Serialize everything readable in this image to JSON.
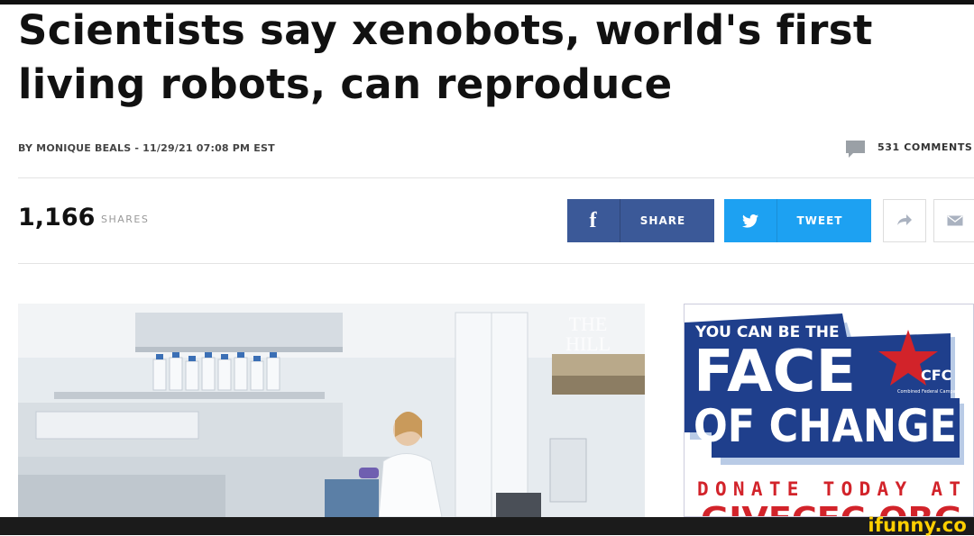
{
  "article": {
    "headline_line1": "Scientists say xenobots, world's first",
    "headline_line2": "living robots, can reproduce",
    "byline": "BY MONIQUE BEALS - 11/29/21 07:08 PM EST",
    "comments": "531 COMMENTS"
  },
  "share_bar": {
    "count": "1,166",
    "count_label": "SHARES",
    "facebook_label": "SHARE",
    "twitter_label": "TWEET"
  },
  "photo": {
    "watermark_line1": "THE",
    "watermark_line2": "HILL"
  },
  "ad": {
    "line1": "YOU CAN BE THE",
    "line2": "FACE",
    "line3": "OF CHANGE",
    "brand": "CFC",
    "brand_tagline": "Combined Federal Campaign",
    "cta": "DONATE TODAY AT",
    "url": "GIVECFC.ORG",
    "colors": {
      "navy": "#1f3f8c",
      "red": "#d2232a",
      "light_blue": "#b9cbe6"
    }
  },
  "watermark": "ifunny.co"
}
